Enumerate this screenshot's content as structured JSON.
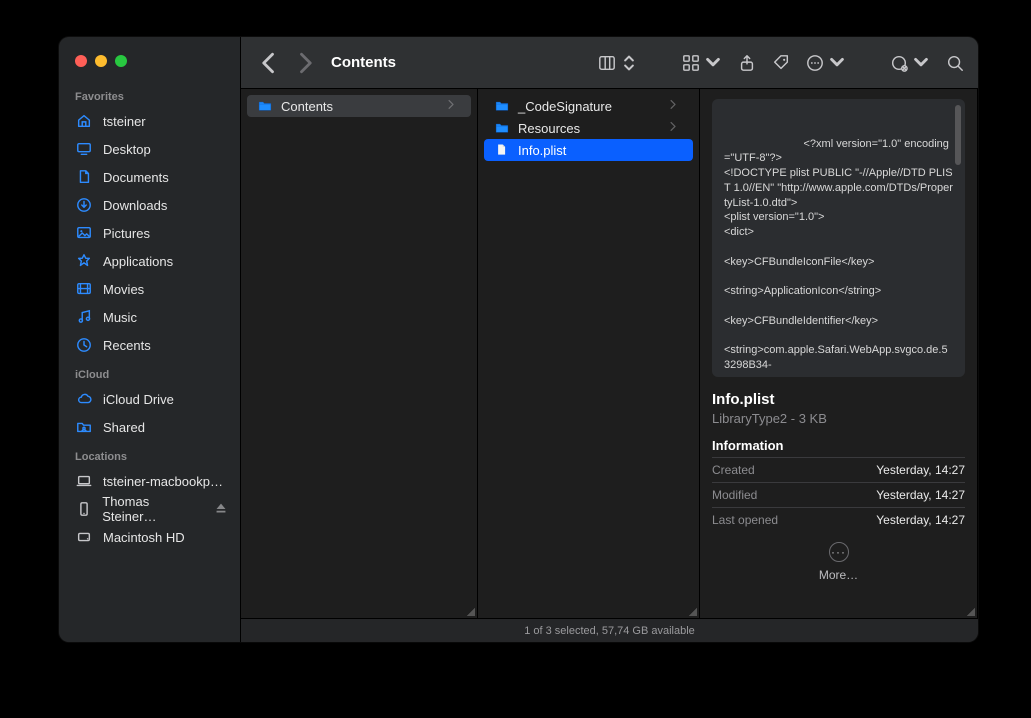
{
  "window": {
    "title": "Contents"
  },
  "toolbar": {
    "view_icon": "columns-icon",
    "group_icon": "grid-icon",
    "share_icon": "share-icon",
    "tags_icon": "tag-icon",
    "actions_icon": "ellipsis-circle-icon",
    "connect_icon": "server-icon",
    "search_icon": "search-icon"
  },
  "sidebar": {
    "sections": [
      {
        "title": "Favorites",
        "items": [
          {
            "icon": "house-icon",
            "label": "tsteiner"
          },
          {
            "icon": "desktop-icon",
            "label": "Desktop"
          },
          {
            "icon": "document-icon",
            "label": "Documents"
          },
          {
            "icon": "download-icon",
            "label": "Downloads"
          },
          {
            "icon": "image-icon",
            "label": "Pictures"
          },
          {
            "icon": "apps-icon",
            "label": "Applications"
          },
          {
            "icon": "movie-icon",
            "label": "Movies"
          },
          {
            "icon": "music-icon",
            "label": "Music"
          },
          {
            "icon": "clock-icon",
            "label": "Recents"
          }
        ]
      },
      {
        "title": "iCloud",
        "items": [
          {
            "icon": "cloud-icon",
            "label": "iCloud Drive"
          },
          {
            "icon": "folder-shared-icon",
            "label": "Shared"
          }
        ]
      },
      {
        "title": "Locations",
        "items": [
          {
            "icon": "laptop-icon",
            "label": "tsteiner-macbookp…"
          },
          {
            "icon": "phone-icon",
            "label": "Thomas Steiner…",
            "eject": true
          },
          {
            "icon": "hdd-icon",
            "label": "Macintosh HD"
          }
        ]
      }
    ]
  },
  "column1": {
    "items": [
      {
        "icon": "folder-icon",
        "label": "Contents",
        "kind": "folder",
        "selected": "dim"
      }
    ]
  },
  "column2": {
    "items": [
      {
        "icon": "folder-icon",
        "label": "_CodeSignature",
        "kind": "folder"
      },
      {
        "icon": "folder-icon",
        "label": "Resources",
        "kind": "folder"
      },
      {
        "icon": "file-icon",
        "label": "Info.plist",
        "kind": "file",
        "selected": "active"
      }
    ]
  },
  "preview": {
    "text": "<?xml version=\"1.0\" encoding=\"UTF-8\"?>\n<!DOCTYPE plist PUBLIC \"-//Apple//DTD PLIST 1.0//EN\" \"http://www.apple.com/DTDs/PropertyList-1.0.dtd\">\n<plist version=\"1.0\">\n<dict>\n\n<key>CFBundleIconFile</key>\n\n<string>ApplicationIcon</string>\n\n<key>CFBundleIdentifier</key>\n\n<string>com.apple.Safari.WebApp.svgco.de.53298B34-"
  },
  "details": {
    "filename": "Info.plist",
    "subtitle": "LibraryType2 - 3 KB",
    "info_heading": "Information",
    "rows": [
      {
        "k": "Created",
        "v": "Yesterday, 14:27"
      },
      {
        "k": "Modified",
        "v": "Yesterday, 14:27"
      },
      {
        "k": "Last opened",
        "v": "Yesterday, 14:27"
      }
    ],
    "more_label": "More…"
  },
  "status": {
    "text": "1 of 3 selected, 57,74 GB available"
  }
}
